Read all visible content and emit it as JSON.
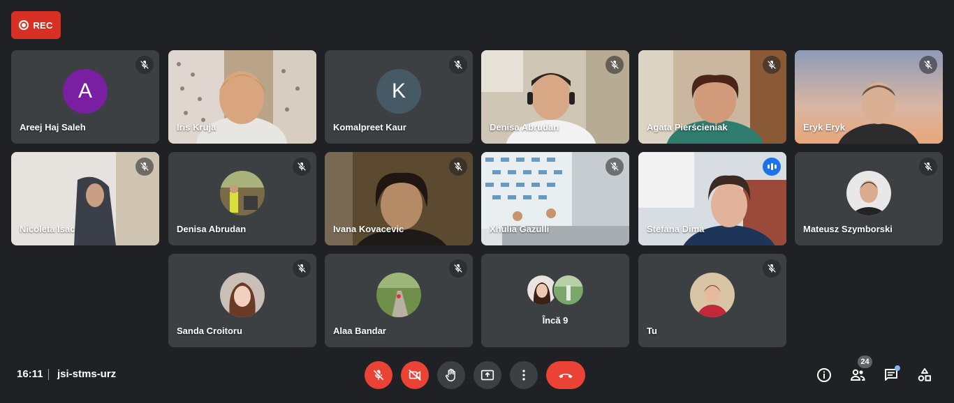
{
  "recording": {
    "label": "REC",
    "color": "#d93025"
  },
  "tiles": [
    {
      "name": "Areej Haj Saleh",
      "initial": "A",
      "avatar_color": "#7b1fa2",
      "muted": true
    },
    {
      "name": "Iris Kruja",
      "muted": false
    },
    {
      "name": "Komalpreet Kaur",
      "initial": "K",
      "avatar_color": "#455a64",
      "muted": true
    },
    {
      "name": "Denisa Abrudan",
      "muted": true
    },
    {
      "name": "Agata Pierścieniak",
      "muted": true
    },
    {
      "name": "Eryk Eryk",
      "muted": true
    },
    {
      "name": "Nicoleta Isac",
      "muted": true
    },
    {
      "name": "Denisa Abrudan",
      "muted": true
    },
    {
      "name": "Ivana Kovacevic",
      "muted": true
    },
    {
      "name": "Xhulia Gazulli",
      "muted": true
    },
    {
      "name": "Stefana Dima",
      "speaking": true
    },
    {
      "name": "Mateusz Szymborski",
      "muted": true
    },
    {
      "name": "Sanda Croitoru",
      "muted": true
    },
    {
      "name": "Alaa Bandar",
      "muted": true
    },
    {
      "name": "Încă 9"
    },
    {
      "name": "Tu",
      "muted": true
    }
  ],
  "bottom_bar": {
    "time": "16:11",
    "meeting_code": "jsi-stms-urz",
    "participants_count": "24",
    "accent_red": "#ea4335",
    "accent_blue": "#8ab4f8"
  }
}
